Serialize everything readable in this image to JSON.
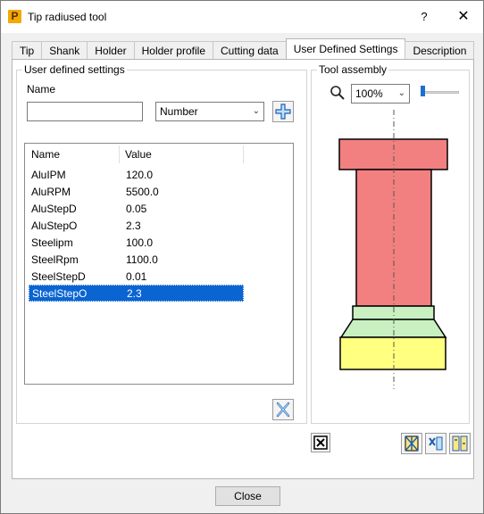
{
  "window": {
    "title": "Tip radiused tool",
    "app_icon_letter": "P",
    "help_label": "?",
    "close_label": "✕"
  },
  "tabs": [
    {
      "label": "Tip",
      "active": false
    },
    {
      "label": "Shank",
      "active": false
    },
    {
      "label": "Holder",
      "active": false
    },
    {
      "label": "Holder profile",
      "active": false
    },
    {
      "label": "Cutting data",
      "active": false
    },
    {
      "label": "User Defined Settings",
      "active": true
    },
    {
      "label": "Description",
      "active": false
    }
  ],
  "user_settings": {
    "group_label": "User defined settings",
    "name_label": "Name",
    "name_value": "",
    "type_select": "Number",
    "list_headers": [
      "Name",
      "Value"
    ],
    "rows": [
      {
        "name": "AluIPM",
        "value": "120.0"
      },
      {
        "name": "AluRPM",
        "value": "5500.0"
      },
      {
        "name": "AluStepD",
        "value": "0.05"
      },
      {
        "name": "AluStepO",
        "value": "2.3"
      },
      {
        "name": "Steelipm",
        "value": "100.0"
      },
      {
        "name": "SteelRpm",
        "value": "1100.0"
      },
      {
        "name": "SteelStepD",
        "value": "0.01"
      },
      {
        "name": "SteelStepO",
        "value": "2.3"
      }
    ],
    "selected_row": "SteelStepO"
  },
  "tool_assembly": {
    "group_label": "Tool assembly",
    "zoom": "100%",
    "colors": {
      "shank": "#f28080",
      "holder_top": "#c8f0c0",
      "holder_bottom": "#ffff80",
      "outline": "#000000"
    }
  },
  "footer": {
    "close_label": "Close"
  },
  "icons": {
    "add": "add-plus-icon",
    "delete": "delete-setting-icon",
    "zoom": "magnifier-icon"
  }
}
